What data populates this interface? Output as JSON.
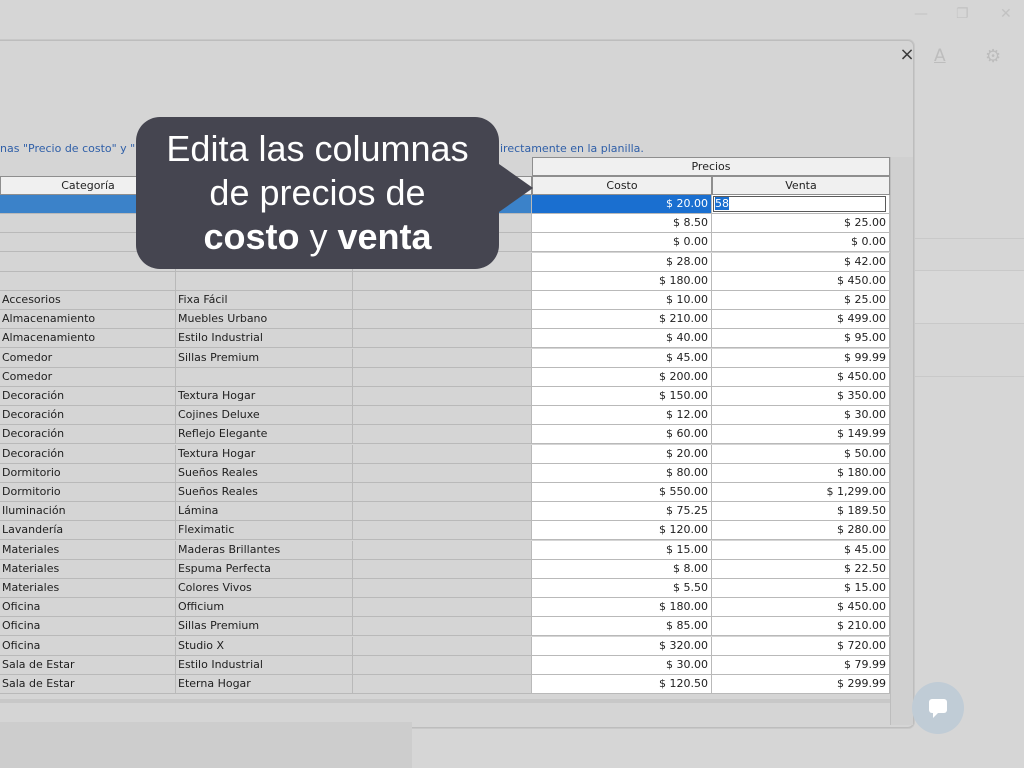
{
  "instructions": {
    "left": "nas \"Precio de costo\" y \"P",
    "right": "irectamente en la planilla."
  },
  "headers": {
    "group": "Precios",
    "categoria": "Categoría",
    "costo": "Costo",
    "venta": "Venta"
  },
  "editing": {
    "value": "58"
  },
  "callout": {
    "line1": "Edita las columnas",
    "line2": "de precios de",
    "word_costo": "costo",
    "word_y": "y",
    "word_venta": "venta"
  },
  "background": {
    "text_icon": "A"
  },
  "close_label": "×",
  "rows": [
    {
      "categoria": "",
      "proveedor": "",
      "costo": "$ 20.00",
      "venta": "",
      "selected": true
    },
    {
      "categoria": "",
      "proveedor": "",
      "costo": "$ 8.50",
      "venta": "$ 25.00"
    },
    {
      "categoria": "",
      "proveedor": "",
      "costo": "$ 0.00",
      "venta": "$ 0.00"
    },
    {
      "categoria": "",
      "proveedor": "",
      "costo": "$ 28.00",
      "venta": "$ 42.00"
    },
    {
      "categoria": "",
      "proveedor": "",
      "costo": "$ 180.00",
      "venta": "$ 450.00"
    },
    {
      "categoria": "Accesorios",
      "proveedor": "Fixa Fácil",
      "costo": "$ 10.00",
      "venta": "$ 25.00"
    },
    {
      "categoria": "Almacenamiento",
      "proveedor": "Muebles Urbano",
      "costo": "$ 210.00",
      "venta": "$ 499.00"
    },
    {
      "categoria": "Almacenamiento",
      "proveedor": "Estilo Industrial",
      "costo": "$ 40.00",
      "venta": "$ 95.00"
    },
    {
      "categoria": "Comedor",
      "proveedor": "Sillas Premium",
      "costo": "$ 45.00",
      "venta": "$ 99.99"
    },
    {
      "categoria": "Comedor",
      "proveedor": "",
      "costo": "$ 200.00",
      "venta": "$ 450.00"
    },
    {
      "categoria": "Decoración",
      "proveedor": "Textura Hogar",
      "costo": "$ 150.00",
      "venta": "$ 350.00"
    },
    {
      "categoria": "Decoración",
      "proveedor": "Cojines Deluxe",
      "costo": "$ 12.00",
      "venta": "$ 30.00"
    },
    {
      "categoria": "Decoración",
      "proveedor": "Reflejo Elegante",
      "costo": "$ 60.00",
      "venta": "$ 149.99"
    },
    {
      "categoria": "Decoración",
      "proveedor": "Textura Hogar",
      "costo": "$ 20.00",
      "venta": "$ 50.00"
    },
    {
      "categoria": "Dormitorio",
      "proveedor": "Sueños Reales",
      "costo": "$ 80.00",
      "venta": "$ 180.00"
    },
    {
      "categoria": "Dormitorio",
      "proveedor": "Sueños Reales",
      "costo": "$ 550.00",
      "venta": "$ 1,299.00"
    },
    {
      "categoria": "Iluminación",
      "proveedor": "Lámina",
      "costo": "$ 75.25",
      "venta": "$ 189.50"
    },
    {
      "categoria": "Lavandería",
      "proveedor": "Fleximatic",
      "costo": "$ 120.00",
      "venta": "$ 280.00"
    },
    {
      "categoria": "Materiales",
      "proveedor": "Maderas Brillantes",
      "costo": "$ 15.00",
      "venta": "$ 45.00"
    },
    {
      "categoria": "Materiales",
      "proveedor": "Espuma Perfecta",
      "costo": "$ 8.00",
      "venta": "$ 22.50"
    },
    {
      "categoria": "Materiales",
      "proveedor": "Colores Vivos",
      "costo": "$ 5.50",
      "venta": "$ 15.00"
    },
    {
      "categoria": "Oficina",
      "proveedor": "Officium",
      "costo": "$ 180.00",
      "venta": "$ 450.00"
    },
    {
      "categoria": "Oficina",
      "proveedor": "Sillas Premium",
      "costo": "$ 85.00",
      "venta": "$ 210.00"
    },
    {
      "categoria": "Oficina",
      "proveedor": "Studio X",
      "costo": "$ 320.00",
      "venta": "$ 720.00"
    },
    {
      "categoria": "Sala de Estar",
      "proveedor": "Estilo Industrial",
      "costo": "$ 30.00",
      "venta": "$ 79.99"
    },
    {
      "categoria": "Sala de Estar",
      "proveedor": "Eterna Hogar",
      "costo": "$ 120.50",
      "venta": "$ 299.99"
    }
  ]
}
